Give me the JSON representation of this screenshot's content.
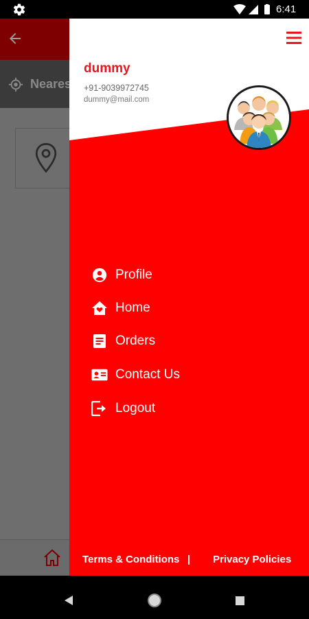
{
  "status_bar": {
    "time": "6:41"
  },
  "background": {
    "nearest_label": "Neares"
  },
  "drawer": {
    "user": {
      "name": "dummy",
      "phone": "+91-9039972745",
      "email": "dummy@mail.com"
    },
    "menu": [
      {
        "label": "Profile",
        "icon": "account-circle-icon"
      },
      {
        "label": "Home",
        "icon": "home-heart-icon"
      },
      {
        "label": "Orders",
        "icon": "receipt-icon"
      },
      {
        "label": "Contact Us",
        "icon": "contact-card-icon"
      },
      {
        "label": "Logout",
        "icon": "logout-icon"
      }
    ],
    "footer": {
      "terms": "Terms & Conditions",
      "separator": "|",
      "privacy": "Privacy Policies"
    }
  },
  "colors": {
    "drawer_red": "#ff0000",
    "brand_text_red": "#e8161b",
    "dim_overlay": "#6e6e6e"
  }
}
